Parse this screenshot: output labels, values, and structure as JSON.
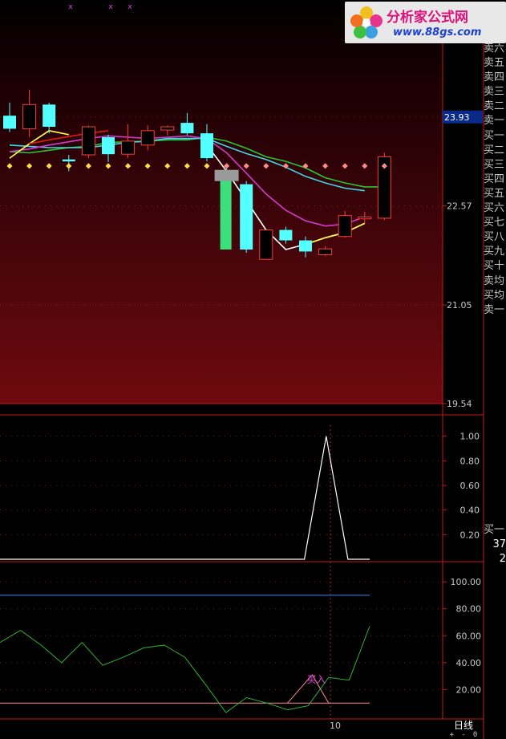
{
  "chart_data": {
    "type": "candlestick",
    "main_panel": {
      "price_labels": [
        "23.93",
        "22.57",
        "21.05",
        "19.54"
      ],
      "current_price_label": "23.93",
      "ylim": [
        19.54,
        24.8
      ],
      "candles": [
        {
          "o": 23.95,
          "h": 24.15,
          "l": 23.7,
          "c": 23.75,
          "up": false
        },
        {
          "o": 23.75,
          "h": 24.35,
          "l": 23.62,
          "c": 24.12,
          "up": true
        },
        {
          "o": 24.12,
          "h": 24.15,
          "l": 23.68,
          "c": 23.78,
          "up": false
        },
        {
          "o": 23.28,
          "h": 23.35,
          "l": 23.1,
          "c": 23.25,
          "up": false
        },
        {
          "o": 23.35,
          "h": 23.8,
          "l": 23.3,
          "c": 23.78,
          "up": true
        },
        {
          "o": 23.62,
          "h": 23.66,
          "l": 23.24,
          "c": 23.36,
          "up": false
        },
        {
          "o": 23.36,
          "h": 23.82,
          "l": 23.3,
          "c": 23.56,
          "up": true
        },
        {
          "o": 23.5,
          "h": 23.8,
          "l": 23.42,
          "c": 23.72,
          "up": true
        },
        {
          "o": 23.73,
          "h": 23.8,
          "l": 23.65,
          "c": 23.78,
          "up": true
        },
        {
          "o": 23.84,
          "h": 23.99,
          "l": 23.65,
          "c": 23.68,
          "up": false
        },
        {
          "o": 23.68,
          "h": 23.82,
          "l": 23.25,
          "c": 23.3,
          "up": false
        },
        {
          "o": 23.1,
          "h": 23.18,
          "l": 22.9,
          "c": 22.98,
          "up": false
        },
        {
          "o": 22.9,
          "h": 22.95,
          "l": 21.85,
          "c": 21.9,
          "up": false
        },
        {
          "o": 21.75,
          "h": 22.2,
          "l": 21.74,
          "c": 22.2,
          "up": true
        },
        {
          "o": 22.2,
          "h": 22.25,
          "l": 21.99,
          "c": 22.04,
          "up": false
        },
        {
          "o": 22.04,
          "h": 22.1,
          "l": 21.78,
          "c": 21.87,
          "up": false
        },
        {
          "o": 21.82,
          "h": 21.95,
          "l": 21.8,
          "c": 21.91,
          "up": true
        },
        {
          "o": 22.1,
          "h": 22.49,
          "l": 22.08,
          "c": 22.42,
          "up": true
        },
        {
          "o": 22.37,
          "h": 22.48,
          "l": 22.3,
          "c": 22.4,
          "up": true
        },
        {
          "o": 22.38,
          "h": 23.38,
          "l": 22.35,
          "c": 23.32,
          "up": true
        }
      ],
      "ma_fast": [
        23.3,
        23.52,
        23.72,
        23.66,
        23.6,
        23.5,
        23.5,
        23.5,
        23.58,
        23.65,
        23.5,
        23.1,
        22.65,
        22.2,
        21.9,
        21.98,
        22.08,
        22.16,
        22.3
      ],
      "ma_mid": [
        23.4,
        23.44,
        23.5,
        23.55,
        23.6,
        23.64,
        23.62,
        23.6,
        23.62,
        23.64,
        23.6,
        23.38,
        23.07,
        22.75,
        22.5,
        22.34,
        22.26,
        22.29,
        22.4
      ],
      "ma_slow": [
        23.5,
        23.48,
        23.46,
        23.46,
        23.46,
        23.5,
        23.54,
        23.56,
        23.6,
        23.6,
        23.6,
        23.48,
        23.37,
        23.28,
        23.16,
        23.02,
        22.92,
        22.84,
        22.8
      ],
      "ma_long": [
        23.4,
        23.38,
        23.42,
        23.46,
        23.48,
        23.54,
        23.55,
        23.56,
        23.58,
        23.58,
        23.62,
        23.56,
        23.45,
        23.32,
        23.25,
        23.15,
        23.0,
        22.92,
        22.86,
        22.86
      ]
    },
    "indicator_1": {
      "yticks": [
        "1.00",
        "0.80",
        "0.60",
        "0.40",
        "0.20"
      ],
      "ylim": [
        0,
        1.05
      ],
      "values": [
        0,
        0,
        0,
        0,
        0,
        0,
        0,
        0,
        0,
        0,
        0,
        0,
        0,
        0,
        0,
        1.0,
        0,
        0
      ]
    },
    "indicator_2": {
      "yticks": [
        "100.00",
        "80.00",
        "60.00",
        "40.00",
        "20.00"
      ],
      "ylim": [
        0,
        112
      ],
      "reference_line_high": 90,
      "reference_line_low": 10,
      "signal_label": "买入",
      "values": [
        55,
        64,
        53,
        40,
        55,
        38,
        44,
        51,
        53,
        44,
        24,
        3,
        14,
        10,
        5,
        8,
        29,
        27,
        67
      ]
    },
    "date_label": "10"
  },
  "side_panel": {
    "order_rows": [
      "卖六",
      "卖五",
      "卖四",
      "卖三",
      "卖二",
      "卖一",
      "买一",
      "买二",
      "买三",
      "买四",
      "买五",
      "买六",
      "买七",
      "买八",
      "买九",
      "买十",
      "卖均",
      "买均",
      "卖一"
    ],
    "lower_rows": [
      "买一",
      "37",
      "2"
    ]
  },
  "footer": {
    "period_label": "日线",
    "zoom_in": "+",
    "zoom_out": "-",
    "reset": "0"
  },
  "logo": {
    "brand": "分析家公式网",
    "url": "www.88gs.com"
  },
  "colors": {
    "up": "#ff3a3a",
    "down": "#54ffff",
    "ma_white": "#ffffff",
    "ma_cyan": "#46d6e6",
    "ma_green": "#28c828",
    "ma_magenta": "#d23ad2",
    "ma_yellow": "#ffff46",
    "ma_red": "#e01818",
    "panel_border": "#c81818",
    "ref_blue": "#2a8cff"
  }
}
